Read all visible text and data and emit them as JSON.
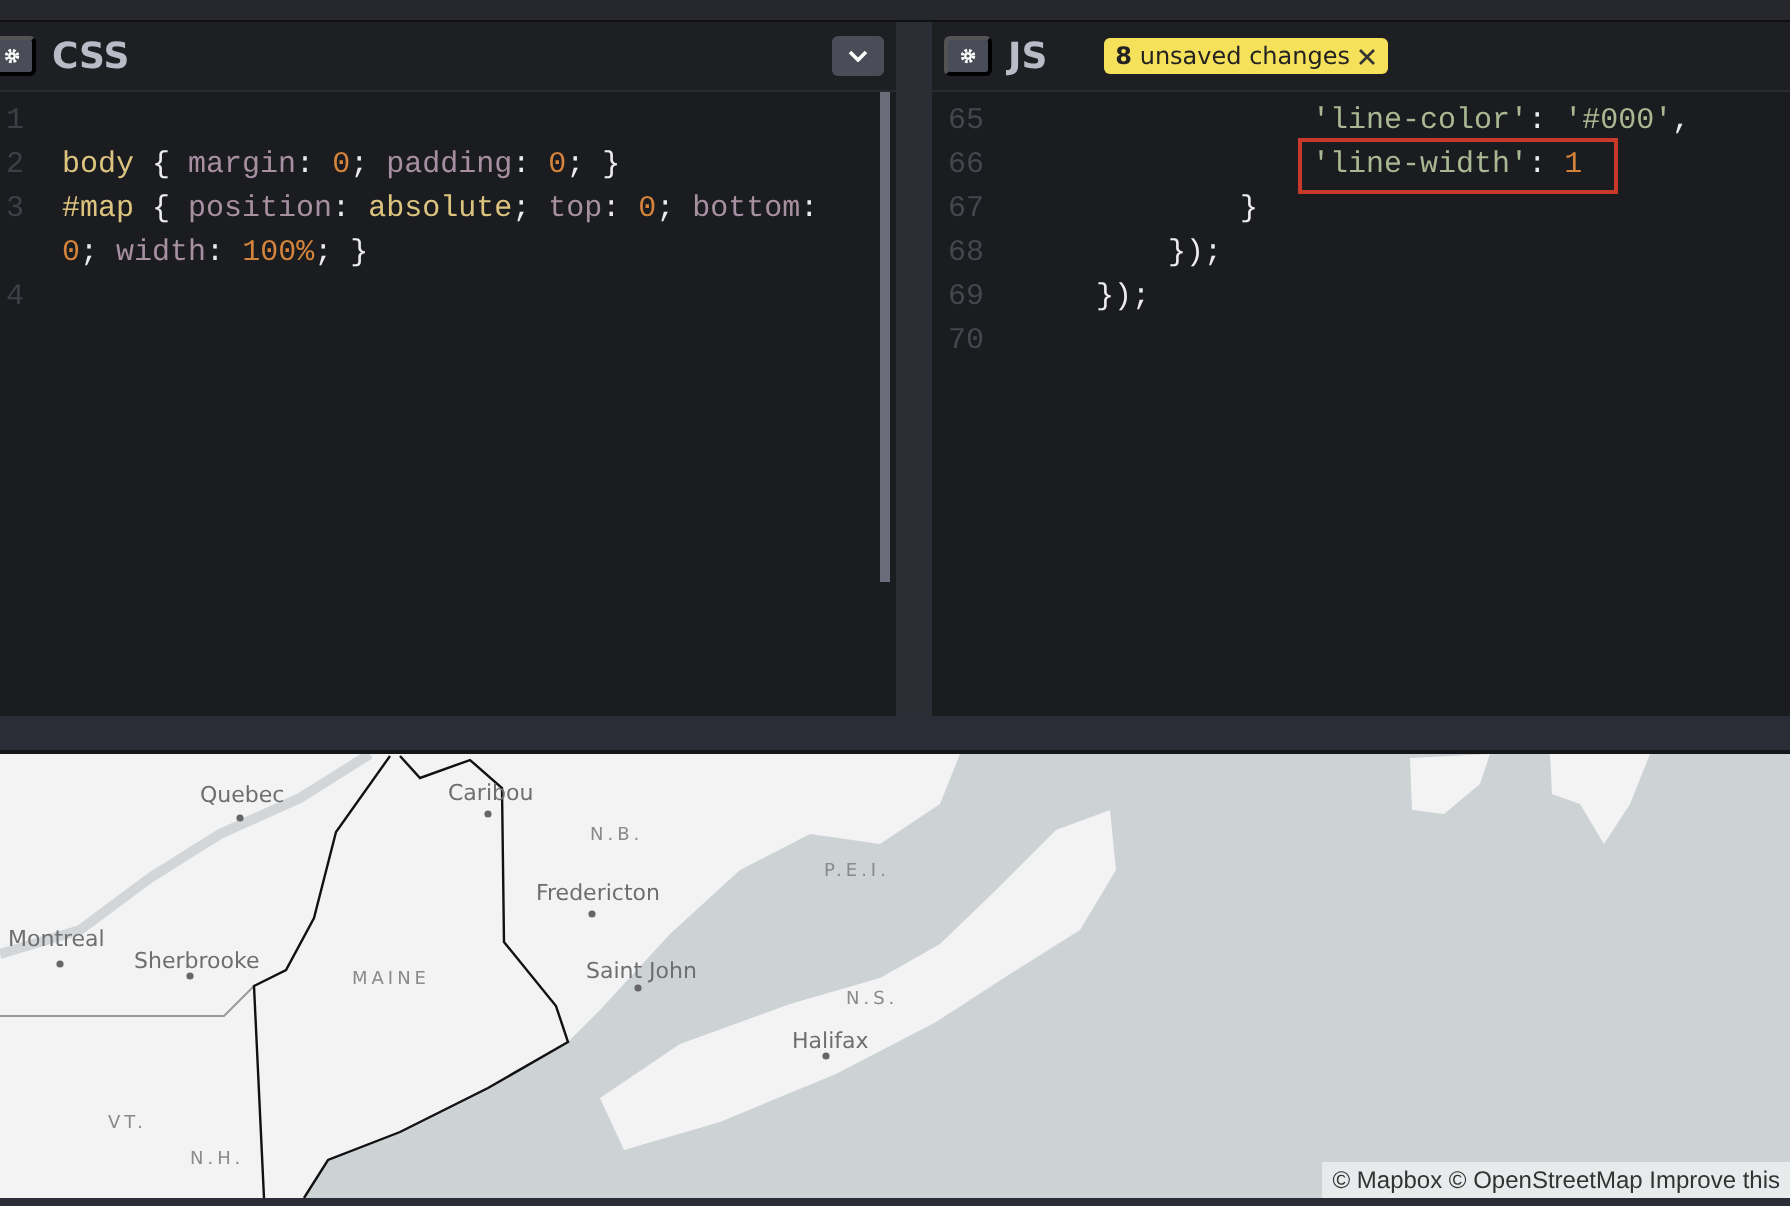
{
  "css_panel": {
    "title": "CSS",
    "lines": [
      {
        "number": "1"
      },
      {
        "number": "2",
        "tokens": [
          {
            "text": "body",
            "kind": "selector"
          },
          {
            "text": " { ",
            "kind": "punct"
          },
          {
            "text": "margin",
            "kind": "property"
          },
          {
            "text": ": ",
            "kind": "punct"
          },
          {
            "text": "0",
            "kind": "number"
          },
          {
            "text": "; ",
            "kind": "punct"
          },
          {
            "text": "padding",
            "kind": "property"
          },
          {
            "text": ": ",
            "kind": "punct"
          },
          {
            "text": "0",
            "kind": "number"
          },
          {
            "text": "; }",
            "kind": "punct"
          }
        ]
      },
      {
        "number": "3",
        "tokens": [
          {
            "text": "#map",
            "kind": "selector"
          },
          {
            "text": " { ",
            "kind": "punct"
          },
          {
            "text": "position",
            "kind": "property"
          },
          {
            "text": ": ",
            "kind": "punct"
          },
          {
            "text": "absolute",
            "kind": "value"
          },
          {
            "text": "; ",
            "kind": "punct"
          },
          {
            "text": "top",
            "kind": "property"
          },
          {
            "text": ": ",
            "kind": "punct"
          },
          {
            "text": "0",
            "kind": "number"
          },
          {
            "text": "; ",
            "kind": "punct"
          },
          {
            "text": "bottom",
            "kind": "property"
          },
          {
            "text": ": ",
            "kind": "punct"
          },
          {
            "text": "0",
            "kind": "number"
          },
          {
            "text": "; ",
            "kind": "punct"
          },
          {
            "text": "width",
            "kind": "property"
          },
          {
            "text": ": ",
            "kind": "punct"
          },
          {
            "text": "100%",
            "kind": "number"
          },
          {
            "text": "; }",
            "kind": "punct"
          }
        ]
      },
      {
        "number": "4"
      }
    ]
  },
  "js_panel": {
    "title": "JS",
    "badge": "**8** unsaved changes",
    "lines": [
      {
        "number": "65",
        "highlighted": false,
        "tokens": [
          {
            "text": "                'line-color'",
            "kind": "string"
          },
          {
            "text": ": ",
            "kind": "punct"
          },
          {
            "text": "'#000'",
            "kind": "string"
          },
          {
            "text": ",",
            "kind": "punct"
          }
        ]
      },
      {
        "number": "66",
        "highlighted": true,
        "tokens": [
          {
            "text": "                'line-width'",
            "kind": "string"
          },
          {
            "text": ": ",
            "kind": "punct"
          },
          {
            "text": "1",
            "kind": "number"
          }
        ]
      },
      {
        "number": "67",
        "highlighted": false,
        "tokens": [
          {
            "text": "            }",
            "kind": "punct"
          }
        ]
      },
      {
        "number": "68",
        "highlighted": false,
        "tokens": [
          {
            "text": "        });",
            "kind": "punct"
          }
        ]
      },
      {
        "number": "69",
        "highlighted": false,
        "tokens": [
          {
            "text": "    });",
            "kind": "punct"
          }
        ]
      },
      {
        "number": "70",
        "highlighted": false
      }
    ]
  },
  "map": {
    "labels": [
      {
        "text": "Quebec",
        "kind": "city"
      },
      {
        "text": "Caribou",
        "kind": "city"
      },
      {
        "text": "N.B.",
        "kind": "region"
      },
      {
        "text": "Fredericton",
        "kind": "city"
      },
      {
        "text": "P.E.I.",
        "kind": "region"
      },
      {
        "text": "Montreal",
        "kind": "city"
      },
      {
        "text": "Sherbrooke",
        "kind": "city"
      },
      {
        "text": "MAINE",
        "kind": "region"
      },
      {
        "text": "Saint John",
        "kind": "city"
      },
      {
        "text": "N.S.",
        "kind": "region"
      },
      {
        "text": "Halifax",
        "kind": "city"
      },
      {
        "text": "VT.",
        "kind": "region"
      },
      {
        "text": "N.H.",
        "kind": "region"
      }
    ],
    "attribution": "© Mapbox © OpenStreetMap Improve this"
  }
}
